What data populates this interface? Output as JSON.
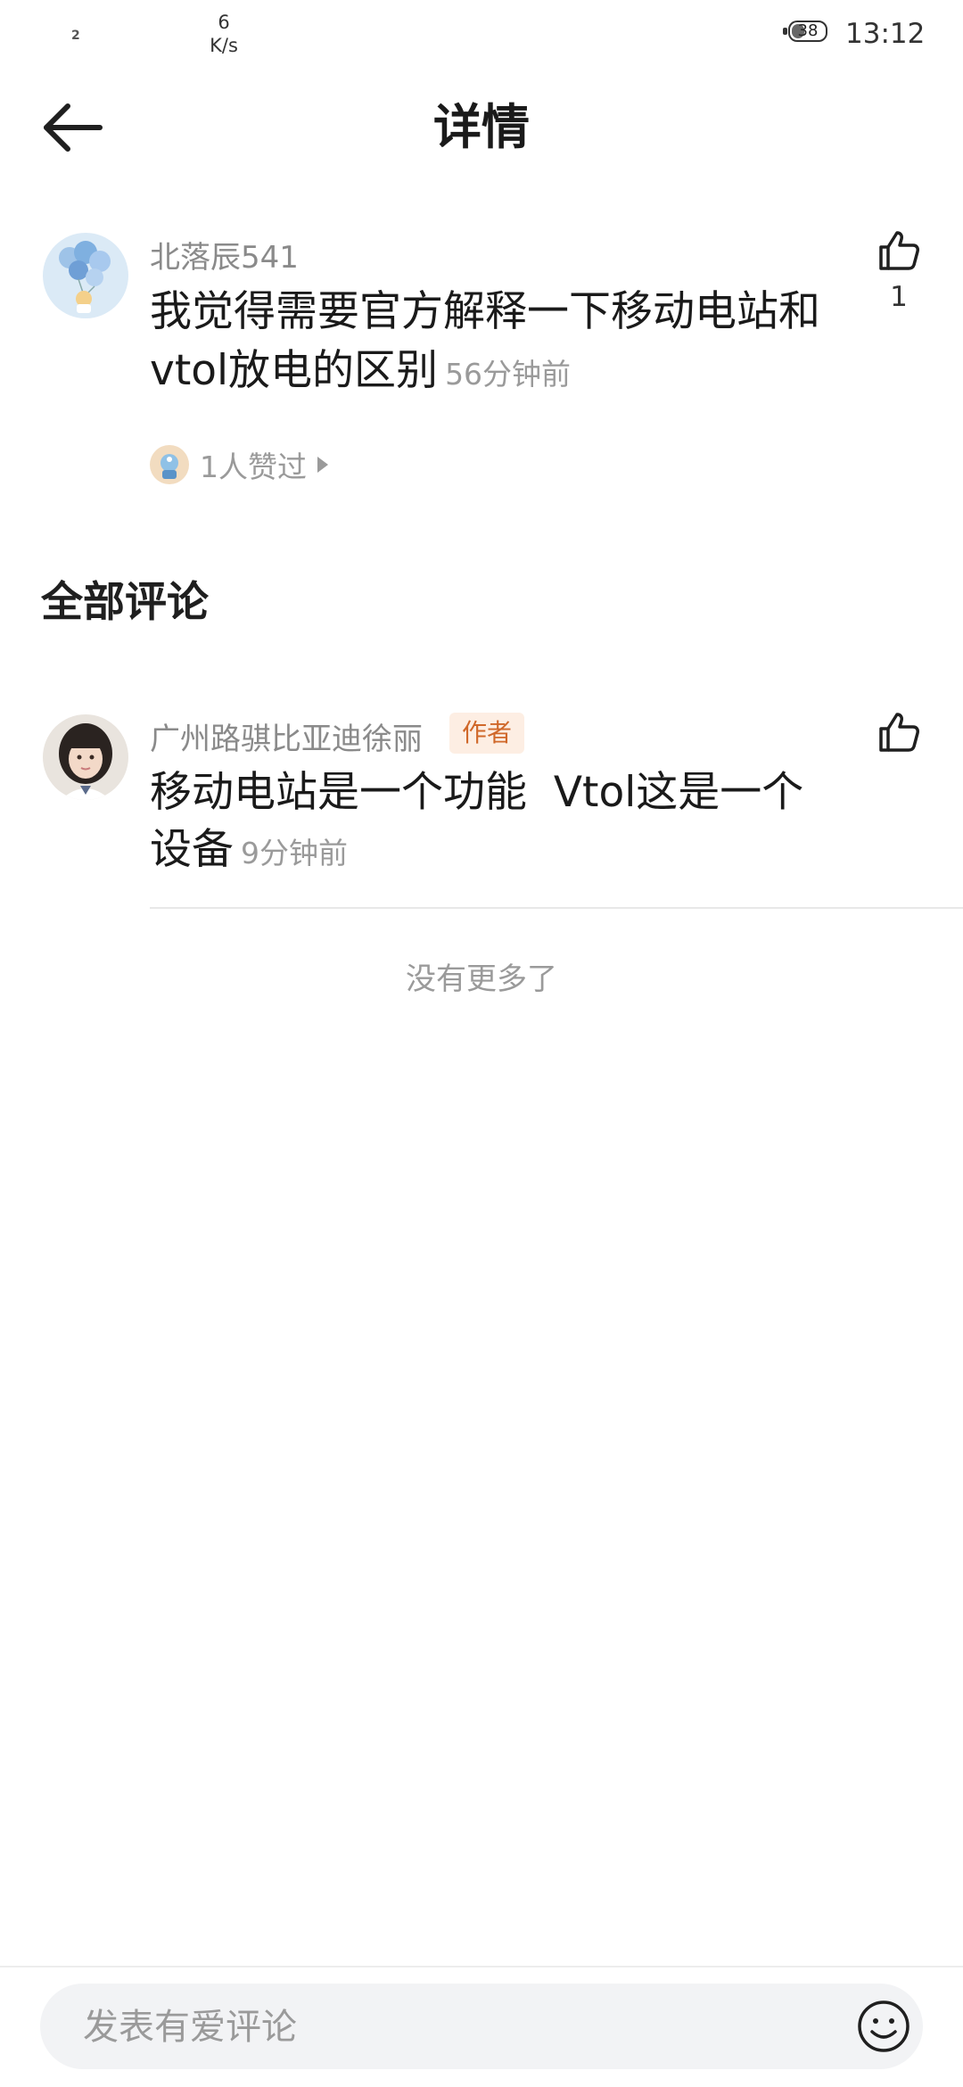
{
  "status_bar": {
    "notif_badge": "2",
    "net_speed_value": "6",
    "net_speed_unit": "K/s",
    "battery": "38",
    "battery_level": 0.38,
    "time": "13:12"
  },
  "header": {
    "title": "详情",
    "back_icon": "arrow-left-icon"
  },
  "post": {
    "username": "北落辰541",
    "text": "我觉得需要官方解释一下移动电站和vtol放电的区别",
    "time": "56分钟前",
    "like_count": "1",
    "liked_by_label": "1人赞过"
  },
  "comments_section": {
    "title": "全部评论"
  },
  "comments": [
    {
      "username": "广州路骐比亚迪徐丽",
      "badge": "作者",
      "text": "移动电站是一个功能  Vtol这是一个设备",
      "time": "9分钟前"
    }
  ],
  "no_more": "没有更多了",
  "bottom_bar": {
    "input_placeholder": "发表有爱评论",
    "emoji_icon": "smiley-icon"
  },
  "colors": {
    "badge_bg": "#fdeee3",
    "badge_text": "#d0682a",
    "muted_text": "#9a9a9a",
    "input_bg": "#f2f3f5"
  }
}
